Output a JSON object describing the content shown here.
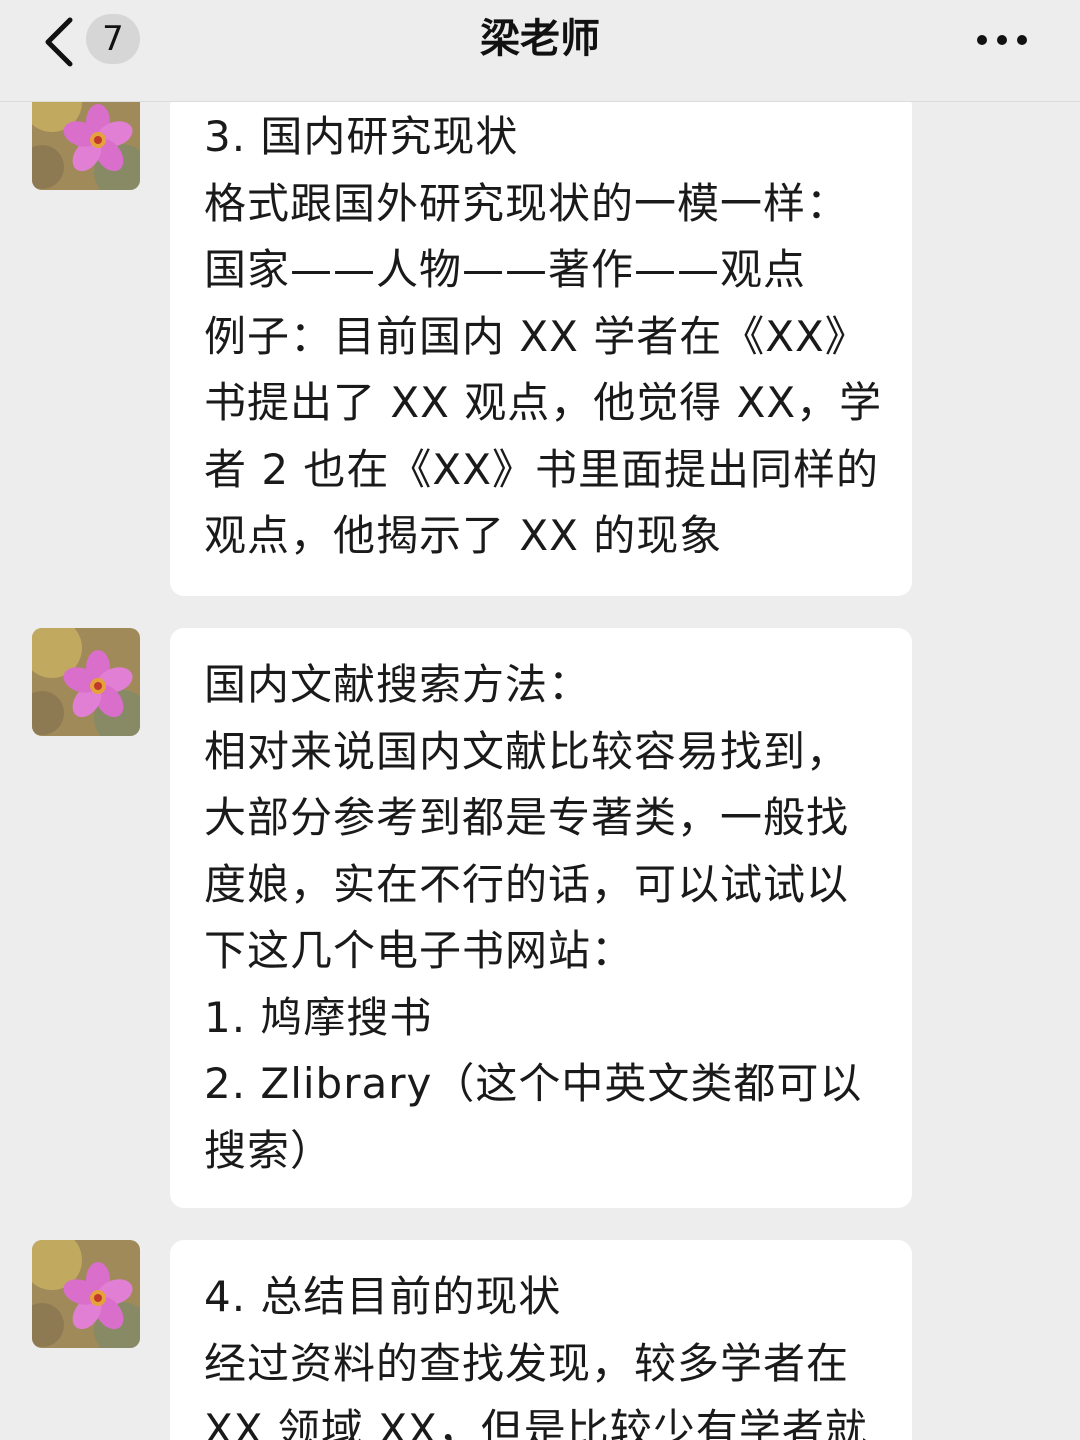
{
  "header": {
    "back_icon": "chevron-left-icon",
    "unread_count": "7",
    "title": "梁老师",
    "more_icon": "more-horizontal-icon"
  },
  "colors": {
    "background": "#ededed",
    "bubble": "#ffffff",
    "text": "#1a1a1a"
  },
  "messages": [
    {
      "avatar": "flower-avatar",
      "lines": [
        "3. 国内研究现状",
        "格式跟国外研究现状的一模一样：",
        "国家——人物——著作——观点",
        "例子：目前国内 XX 学者在《XX》",
        "书提出了 XX 观点，他觉得 XX，学",
        "者 2 也在《XX》书里面提出同样的",
        "观点，他揭示了 XX 的现象"
      ]
    },
    {
      "avatar": "flower-avatar",
      "lines": [
        "国内文献搜索方法：",
        "相对来说国内文献比较容易找到，",
        "大部分参考到都是专著类，一般找",
        "度娘，实在不行的话，可以试试以",
        "下这几个电子书网站：",
        "1. 鸠摩搜书",
        "2. Zlibrary（这个中英文类都可以",
        "搜索）"
      ]
    },
    {
      "avatar": "flower-avatar",
      "lines": [
        "4. 总结目前的现状",
        "经过资料的查找发现，较多学者在",
        "XX 领域 XX，但是比较少有学者就"
      ]
    }
  ]
}
